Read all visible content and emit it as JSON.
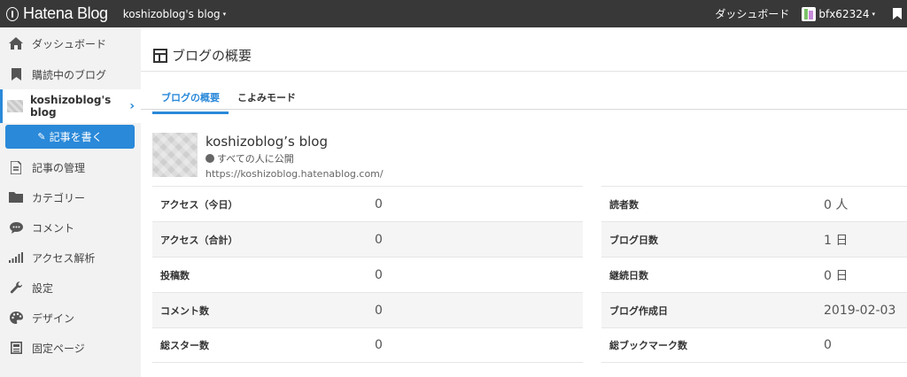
{
  "topbar": {
    "logo_text": "Hatena Blog",
    "blog_name": "koshizoblog's blog",
    "caret": "▾",
    "dashboard_link": "ダッシュボード",
    "username": "bfx62324",
    "user_caret": "▾"
  },
  "sidebar": {
    "items": [
      {
        "label": "ダッシュボード",
        "icon": "home-icon"
      },
      {
        "label": "購読中のブログ",
        "icon": "bookmark-icon"
      },
      {
        "label": "koshizoblog's blog",
        "icon": "blog-thumbnail"
      },
      {
        "label": "記事の管理",
        "icon": "document-icon"
      },
      {
        "label": "カテゴリー",
        "icon": "folder-icon"
      },
      {
        "label": "コメント",
        "icon": "comment-icon"
      },
      {
        "label": "アクセス解析",
        "icon": "bar-chart-icon"
      },
      {
        "label": "設定",
        "icon": "wrench-icon"
      },
      {
        "label": "デザイン",
        "icon": "palette-icon"
      },
      {
        "label": "固定ページ",
        "icon": "page-icon"
      }
    ],
    "write_button": "記事を書く",
    "active_arrow": "›"
  },
  "main": {
    "title": "ブログの概要",
    "tabs": [
      {
        "label": "ブログの概要",
        "active": true
      },
      {
        "label": "こよみモード",
        "active": false
      }
    ],
    "blog": {
      "name": "koshizoblog’s blog",
      "visibility": "すべての人に公開",
      "url": "https://koshizoblog.hatenablog.com/"
    },
    "stats_left": [
      {
        "label": "アクセス（今日）",
        "value": "0"
      },
      {
        "label": "アクセス（合計）",
        "value": "0"
      },
      {
        "label": "投稿数",
        "value": "0"
      },
      {
        "label": "コメント数",
        "value": "0"
      },
      {
        "label": "総スター数",
        "value": "0"
      }
    ],
    "stats_right": [
      {
        "label": "読者数",
        "value": "0 人"
      },
      {
        "label": "ブログ日数",
        "value": "1 日"
      },
      {
        "label": "継続日数",
        "value": "0 日"
      },
      {
        "label": "ブログ作成日",
        "value": "2019-02-03"
      },
      {
        "label": "総ブックマーク数",
        "value": "0"
      }
    ]
  },
  "colors": {
    "accent": "#2a89d9",
    "topbar": "#383838",
    "sidebar": "#f2f2f2"
  }
}
